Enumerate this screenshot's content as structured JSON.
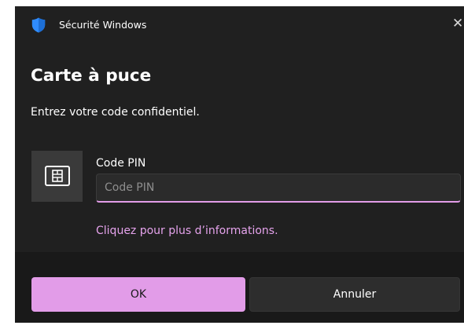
{
  "window": {
    "app_title": "Sécurité Windows",
    "app_icon": "shield-icon",
    "close_glyph": "✕",
    "close_icon": "close-icon"
  },
  "dialog": {
    "title": "Carte à puce",
    "prompt": "Entrez votre code confidentiel.",
    "card_icon": "smart-card-icon",
    "pin": {
      "label": "Code PIN",
      "placeholder": "Code PIN",
      "value": ""
    },
    "more_info_link": "Cliquez pour plus d’informations."
  },
  "footer": {
    "ok_label": "OK",
    "cancel_label": "Annuler"
  },
  "colors": {
    "window_bg": "#202020",
    "footer_bg": "#191919",
    "accent": "#e29ce8",
    "link": "#e5a3ec",
    "shield": "#2f8cff"
  }
}
